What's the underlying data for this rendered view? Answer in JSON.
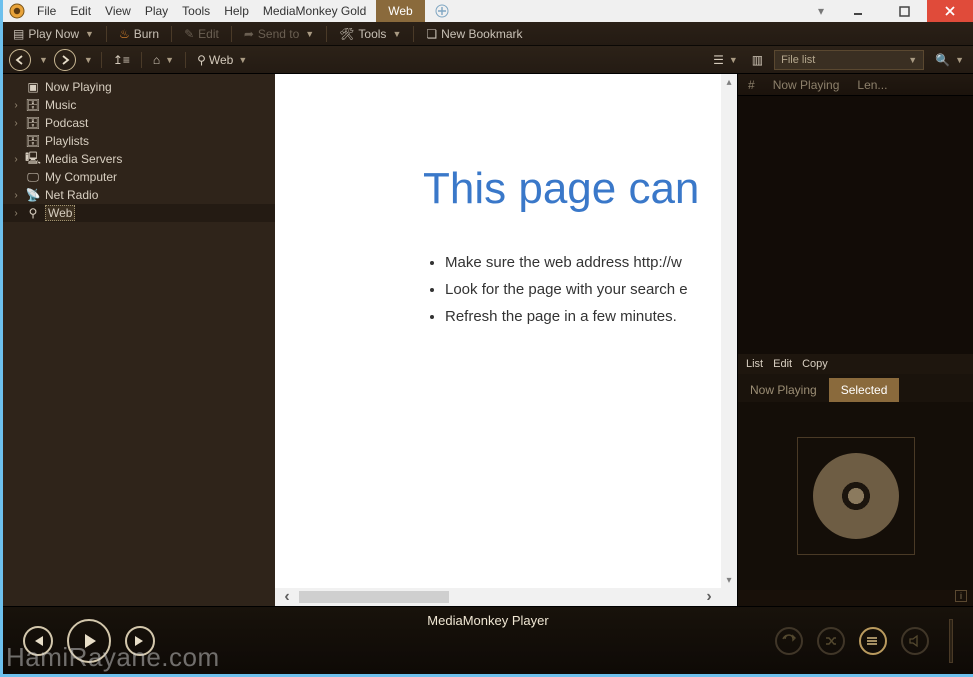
{
  "menu": {
    "file": "File",
    "edit": "Edit",
    "view": "View",
    "play": "Play",
    "tools": "Tools",
    "help": "Help",
    "brand": "MediaMonkey Gold"
  },
  "tab": {
    "web": "Web"
  },
  "toolbar": {
    "play_now": "Play Now",
    "burn": "Burn",
    "edit": "Edit",
    "send_to": "Send to",
    "tools": "Tools",
    "new_bookmark": "New Bookmark"
  },
  "nav": {
    "crumb": "Web",
    "filelist": "File list"
  },
  "tree": {
    "now_playing": "Now Playing",
    "music": "Music",
    "podcast": "Podcast",
    "playlists": "Playlists",
    "media_servers": "Media Servers",
    "my_computer": "My Computer",
    "net_radio": "Net Radio",
    "web": "Web"
  },
  "page": {
    "title": "This page can",
    "b1": "Make sure the web address http://w",
    "b2": "Look for the page with your search e",
    "b3": "Refresh the page in a few minutes."
  },
  "listhead": {
    "num": "#",
    "np": "Now Playing",
    "len": "Len..."
  },
  "submenu": {
    "list": "List",
    "edit": "Edit",
    "copy": "Copy"
  },
  "subtabs": {
    "np": "Now Playing",
    "sel": "Selected"
  },
  "player": {
    "title": "MediaMonkey Player"
  },
  "watermark": "HamiRayane.com"
}
